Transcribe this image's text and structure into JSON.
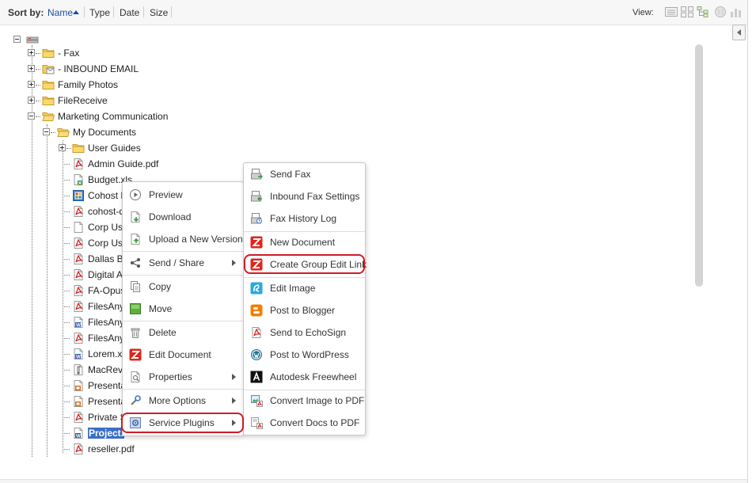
{
  "toolbar": {
    "sort_by_label": "Sort by:",
    "sort_options": [
      "Name",
      "Type",
      "Date",
      "Size"
    ],
    "active_sort": "Name",
    "view_label": "View:",
    "view_icons": [
      "list-view-icon",
      "thumbnail-view-icon",
      "tree-view-icon",
      "globe-view-icon",
      "chart-view-icon"
    ]
  },
  "tree": {
    "root_icon": "drive-icon",
    "items": [
      {
        "label": "- Fax",
        "icon": "folder-icon",
        "expander": "plus"
      },
      {
        "label": "- INBOUND EMAIL",
        "icon": "mail-folder-icon",
        "expander": "plus"
      },
      {
        "label": "Family Photos",
        "icon": "folder-icon",
        "expander": "plus"
      },
      {
        "label": "FileReceive",
        "icon": "folder-icon",
        "expander": "plus"
      },
      {
        "label": "Marketing Communication",
        "icon": "open-folder-icon",
        "expander": "minus"
      },
      {
        "label": "My Documents",
        "icon": "open-folder-icon",
        "expander": "minus"
      },
      {
        "label": "User Guides",
        "icon": "folder-icon",
        "expander": "plus"
      },
      {
        "label": "Admin Guide.pdf",
        "icon": "pdf-icon"
      },
      {
        "label": "Budget.xls",
        "icon": "excel-icon"
      },
      {
        "label": "Cohost L",
        "icon": "image-file-icon"
      },
      {
        "label": "cohost-da",
        "icon": "pdf-icon"
      },
      {
        "label": "Corp Use",
        "icon": "blank-file-icon"
      },
      {
        "label": "Corp Use",
        "icon": "pdf-icon"
      },
      {
        "label": "Dallas Bu",
        "icon": "pdf-icon"
      },
      {
        "label": "Digital Ar",
        "icon": "pdf-icon"
      },
      {
        "label": "FA-Opus-",
        "icon": "pdf-icon"
      },
      {
        "label": "FilesAnyw",
        "icon": "pdf-icon"
      },
      {
        "label": "FilesAnyw",
        "icon": "word-icon"
      },
      {
        "label": "FilesAnyw",
        "icon": "pdf-icon"
      },
      {
        "label": "Lorem.xr",
        "icon": "word-icon"
      },
      {
        "label": "MacRevie",
        "icon": "zip-icon"
      },
      {
        "label": "Presenta",
        "icon": "ppt-icon"
      },
      {
        "label": "Presenta",
        "icon": "ppt-icon"
      },
      {
        "label": "Private S",
        "icon": "pdf-icon"
      },
      {
        "label": "Project.",
        "icon": "word-icon",
        "selected": true
      },
      {
        "label": "reseller.pdf",
        "icon": "pdf-icon"
      }
    ]
  },
  "context_menu": {
    "items": [
      {
        "label": "Preview",
        "icon": "preview-icon"
      },
      {
        "label": "Download",
        "icon": "download-icon"
      },
      {
        "label": "Upload a New Version",
        "icon": "upload-icon"
      },
      {
        "label": "Send / Share",
        "icon": "share-icon",
        "submenu": true
      },
      {
        "label": "Copy",
        "icon": "copy-icon"
      },
      {
        "label": "Move",
        "icon": "move-icon"
      },
      {
        "label": "Delete",
        "icon": "trash-icon"
      },
      {
        "label": "Edit Document",
        "icon": "zoho-icon"
      },
      {
        "label": "Properties",
        "icon": "properties-icon",
        "submenu": true
      },
      {
        "label": "More Options",
        "icon": "wrench-icon",
        "submenu": true
      },
      {
        "label": "Service Plugins",
        "icon": "plugins-icon",
        "submenu": true,
        "highlighted": true
      }
    ]
  },
  "plugins_menu": {
    "items": [
      {
        "label": "Send Fax",
        "icon": "fax-send-icon"
      },
      {
        "label": "Inbound Fax Settings",
        "icon": "fax-settings-icon"
      },
      {
        "label": "Fax History Log",
        "icon": "fax-log-icon"
      },
      {
        "label": "New Document",
        "icon": "zoho-icon"
      },
      {
        "label": "Create Group Edit Link",
        "icon": "zoho-icon",
        "highlighted": true
      },
      {
        "label": "Edit Image",
        "icon": "aviary-icon"
      },
      {
        "label": "Post to Blogger",
        "icon": "blogger-icon"
      },
      {
        "label": "Send to EchoSign",
        "icon": "echosign-icon"
      },
      {
        "label": "Post to WordPress",
        "icon": "wordpress-icon"
      },
      {
        "label": "Autodesk Freewheel",
        "icon": "autodesk-icon"
      },
      {
        "label": "Convert Image to PDF",
        "icon": "image-to-pdf-icon"
      },
      {
        "label": "Convert Docs to PDF",
        "icon": "docs-to-pdf-icon"
      }
    ]
  },
  "colors": {
    "accent": "#1a4fa6",
    "highlight_ring": "#d01b27",
    "selection": "#3b6fc6"
  }
}
